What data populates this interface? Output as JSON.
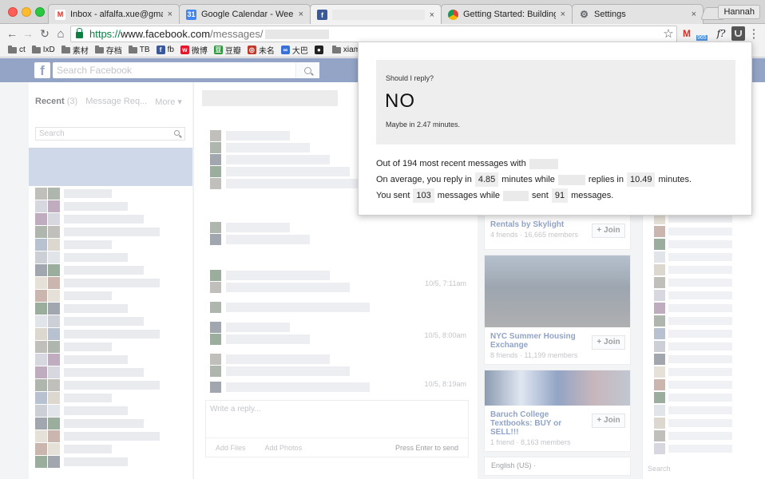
{
  "tabs": [
    {
      "title": "Inbox - alfalfa.xue@gmail.co",
      "icon": "gmail-icon",
      "color": "#d93025",
      "glyph": "M"
    },
    {
      "title": "Google Calendar - Week of O",
      "icon": "calendar-icon",
      "color": "#4285f4",
      "glyph": "31"
    },
    {
      "title": "",
      "icon": "facebook-icon",
      "color": "#3b5998",
      "glyph": "f"
    },
    {
      "title": "Getting Started: Building a C",
      "icon": "chrome-icon",
      "color": "#e8453c",
      "glyph": ""
    },
    {
      "title": "Settings",
      "icon": "gear-icon",
      "color": "#5f6368",
      "glyph": "⚙"
    }
  ],
  "tab_close": "×",
  "profile_name": "Hannah",
  "nav": {
    "back": "←",
    "forward": "→",
    "reload": "↻",
    "home": "⌂"
  },
  "url": {
    "scheme": "https://",
    "host": "www.facebook.com",
    "path": "/messages/"
  },
  "toolbar_extras": {
    "star": "☆",
    "gmail": "M",
    "badge": "965",
    "fx": "f?",
    "menu": "⋮"
  },
  "bookmarks": [
    {
      "label": "ct",
      "icon": "folder-icon"
    },
    {
      "label": "IxD",
      "icon": "folder-icon"
    },
    {
      "label": "素材",
      "icon": "folder-icon"
    },
    {
      "label": "存档",
      "icon": "folder-icon"
    },
    {
      "label": "TB",
      "icon": "folder-icon"
    },
    {
      "label": "fb",
      "icon": "facebook-icon",
      "color": "#3b5998",
      "glyph": "f"
    },
    {
      "label": "微博",
      "icon": "weibo-icon",
      "color": "#e6162d",
      "glyph": "w"
    },
    {
      "label": "豆瓣",
      "icon": "douban-icon",
      "color": "#2e963d",
      "glyph": "豆"
    },
    {
      "label": "未名",
      "icon": "weiming-icon",
      "color": "#c0392b",
      "glyph": "◎"
    },
    {
      "label": "大巴",
      "icon": "daba-icon",
      "color": "#3a6fd8",
      "glyph": "∞"
    },
    {
      "label": "",
      "icon": "paw-icon",
      "color": "#222222",
      "glyph": "●"
    },
    {
      "label": "xiam",
      "icon": "folder-icon"
    }
  ],
  "facebook": {
    "search_placeholder": "Search Facebook",
    "left_tabs": {
      "recent": "Recent",
      "recent_count": "(3)",
      "requests": "Message Req...",
      "more": "More ▾"
    },
    "left_search_placeholder": "Search",
    "timestamps": [
      "10/5, 7:11am",
      "10/5, 8:00am",
      "10/5, 8:19am"
    ],
    "reply_placeholder": "Write a reply...",
    "add_files": "Add Files",
    "add_photos": "Add Photos",
    "press_enter": "Press Enter to send",
    "groups": [
      {
        "name": "Rentals by Skylight",
        "meta": "4 friends · 16,665 members",
        "join": "+ Join"
      },
      {
        "name": "NYC Summer Housing Exchange",
        "meta": "8 friends · 11,199 members",
        "join": "+ Join"
      },
      {
        "name": "Baruch College Textbooks: BUY or SELL!!!",
        "meta": "1 friend · 8,163 members",
        "join": "+ Join"
      }
    ],
    "language": "English (US) ·",
    "chat_search": "Search"
  },
  "popup": {
    "question": "Should I reply?",
    "answer": "NO",
    "subtext": "Maybe in 2.47 minutes.",
    "line1_prefix": "Out of 194 most recent messages with",
    "line2_a": "On average, you reply in",
    "your_avg": "4.85",
    "line2_b": "minutes while",
    "line2_c": "replies in",
    "their_avg": "10.49",
    "line2_d": "minutes.",
    "line3_a": "You sent",
    "you_sent": "103",
    "line3_b": "messages while",
    "line3_c": "sent",
    "they_sent": "91",
    "line3_d": "messages."
  }
}
